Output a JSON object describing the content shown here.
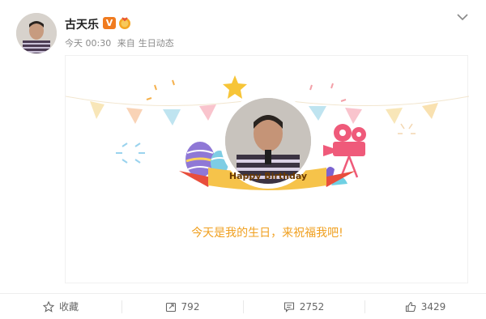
{
  "post": {
    "username": "古天乐",
    "verified_badge": "V",
    "time": "今天 00:30",
    "source_prefix": "来自",
    "source": "生日动态",
    "banner_ribbon_text": "Happy Birthday",
    "greeting": "今天是我的生日，来祝福我吧!"
  },
  "actions": {
    "favorite": "收藏",
    "repost_count": "792",
    "comment_count": "2752",
    "like_count": "3429"
  },
  "colors": {
    "accent": "#f07b1f",
    "greeting": "#f0a020",
    "ribbon": "#f6c34a"
  }
}
